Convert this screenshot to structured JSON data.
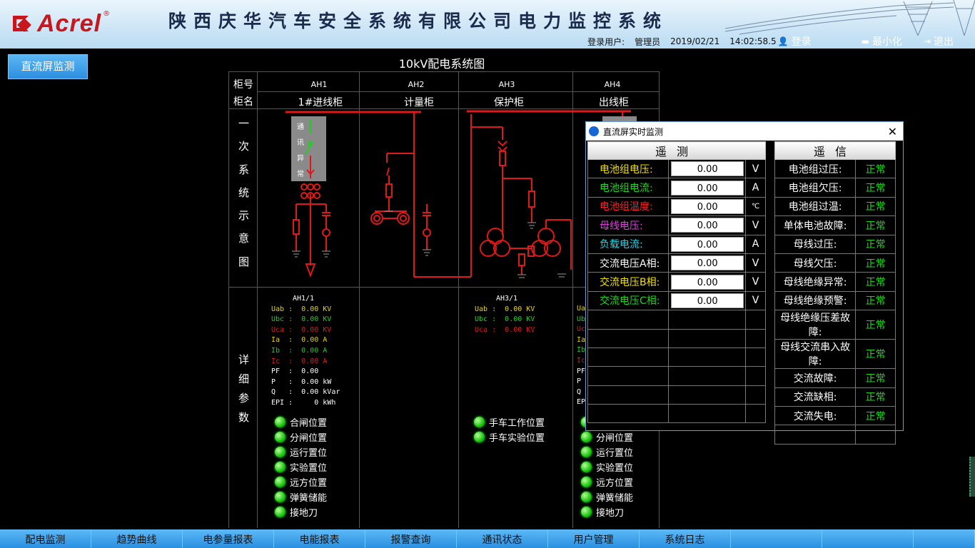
{
  "header": {
    "logo_text": "Acrel",
    "logo_reg": "®",
    "system_title": "陕西庆华汽车安全系统有限公司电力监控系统",
    "login_user_label": "登录用户:",
    "user_name": "管理员",
    "date": "2019/02/21",
    "time": "14:02:58.5",
    "login_btn": "登录",
    "minimize_btn": "最小化",
    "exit_btn": "退出"
  },
  "left_button": "直流屏监测",
  "diagram": {
    "title": "10kV配电系统图",
    "row_cabinet_no": "柜号",
    "row_cabinet_name": "柜名",
    "cabinets": [
      {
        "no": "AH1",
        "name": "1#进线柜"
      },
      {
        "no": "AH2",
        "name": "计量柜"
      },
      {
        "no": "AH3",
        "name": "保护柜"
      },
      {
        "no": "AH4",
        "name": "出线柜"
      }
    ],
    "primary_label": [
      "一",
      "次",
      "系",
      "统",
      "示",
      "意",
      "图"
    ],
    "detail_label": [
      "详",
      "细",
      "参",
      "数"
    ],
    "comm_fault": [
      "通",
      "讯",
      "异",
      "常"
    ],
    "ah1_meas": {
      "title": "AH1/1",
      "rows": [
        {
          "k": "Uab",
          "v": "0.00",
          "u": "KV",
          "c": "#e8d400"
        },
        {
          "k": "Ubc",
          "v": "0.00",
          "u": "KV",
          "c": "#19d219"
        },
        {
          "k": "Uca",
          "v": "0.00",
          "u": "KV",
          "c": "#e01a1a"
        },
        {
          "k": "Ia ",
          "v": "0.00",
          "u": "A",
          "c": "#e8d400"
        },
        {
          "k": "Ib ",
          "v": "0.00",
          "u": "A",
          "c": "#19d219"
        },
        {
          "k": "Ic ",
          "v": "0.00",
          "u": "A",
          "c": "#e01a1a"
        },
        {
          "k": "PF ",
          "v": "0.00",
          "u": "",
          "c": "#ffffff"
        },
        {
          "k": "P  ",
          "v": "0.00",
          "u": "kW",
          "c": "#ffffff"
        },
        {
          "k": "Q  ",
          "v": "0.00",
          "u": "kVar",
          "c": "#ffffff"
        },
        {
          "k": "EPI",
          "v": "   0",
          "u": "kWh",
          "c": "#ffffff"
        }
      ]
    },
    "ah3_meas": {
      "title": "AH3/1",
      "rows": [
        {
          "k": "Uab",
          "v": "0.00",
          "u": "KV",
          "c": "#e8d400"
        },
        {
          "k": "Ubc",
          "v": "0.00",
          "u": "KV",
          "c": "#19d219"
        },
        {
          "k": "Uca",
          "v": "0.00",
          "u": "KV",
          "c": "#e01a1a"
        }
      ]
    },
    "ah4_meas_partial": [
      {
        "k": "Ua",
        "c": "#e8d400"
      },
      {
        "k": "Ub",
        "c": "#19d219"
      },
      {
        "k": "Uc",
        "c": "#e01a1a"
      },
      {
        "k": "Ia",
        "c": "#e8d400"
      },
      {
        "k": "Ib",
        "c": "#19d219"
      },
      {
        "k": "Ic",
        "c": "#e01a1a"
      },
      {
        "k": "PF",
        "c": "#ffffff"
      },
      {
        "k": "P",
        "c": "#ffffff"
      },
      {
        "k": "Q",
        "c": "#ffffff"
      },
      {
        "k": "EP",
        "c": "#ffffff"
      }
    ],
    "ah1_leds": [
      "合闸位置",
      "分闸位置",
      "运行置位",
      "实验置位",
      "远方位置",
      "弹簧储能",
      "接地刀"
    ],
    "ah3_leds": [
      "手车工作位置",
      "手车实验位置"
    ],
    "ah4_leds": [
      "",
      "分闸位置",
      "运行置位",
      "实验置位",
      "远方位置",
      "弹簧储能",
      "接地刀"
    ]
  },
  "popup": {
    "title": "直流屏实时监测",
    "left_header": "遥测",
    "right_header": "遥信",
    "measure_rows": [
      {
        "label": "电池组电压:",
        "value": "0.00",
        "unit": "V",
        "color": "#f2e100"
      },
      {
        "label": "电池组电流:",
        "value": "0.00",
        "unit": "A",
        "color": "#1bd81b"
      },
      {
        "label": "电池组温度:",
        "value": "0.00",
        "unit": "℃",
        "color": "#ff2020"
      },
      {
        "label": "母线电压:",
        "value": "0.00",
        "unit": "V",
        "color": "#e040e0"
      },
      {
        "label": "负载电流:",
        "value": "0.00",
        "unit": "A",
        "color": "#20d8e8"
      },
      {
        "label": "交流电压A相:",
        "value": "0.00",
        "unit": "V",
        "color": "#ffffff"
      },
      {
        "label": "交流电压B相:",
        "value": "0.00",
        "unit": "V",
        "color": "#f2e100"
      },
      {
        "label": "交流电压C相:",
        "value": "0.00",
        "unit": "V",
        "color": "#1bd81b"
      }
    ],
    "status_rows": [
      {
        "label": "电池组过压:",
        "state": "正常"
      },
      {
        "label": "电池组欠压:",
        "state": "正常"
      },
      {
        "label": "电池组过温:",
        "state": "正常"
      },
      {
        "label": "单体电池故障:",
        "state": "正常"
      },
      {
        "label": "母线过压:",
        "state": "正常"
      },
      {
        "label": "母线欠压:",
        "state": "正常"
      },
      {
        "label": "母线绝缘异常:",
        "state": "正常"
      },
      {
        "label": "母线绝缘预警:",
        "state": "正常"
      },
      {
        "label": "母线绝缘压差故障:",
        "state": "正常"
      },
      {
        "label": "母线交流串入故障:",
        "state": "正常"
      },
      {
        "label": "交流故障:",
        "state": "正常"
      },
      {
        "label": "交流缺相:",
        "state": "正常"
      },
      {
        "label": "交流失电:",
        "state": "正常"
      },
      {
        "label": "",
        "state": ""
      }
    ]
  },
  "bottom_nav": [
    "配电监测",
    "趋势曲线",
    "电参量报表",
    "电能报表",
    "报警查询",
    "通讯状态",
    "用户管理",
    "系统日志",
    "",
    "",
    ""
  ]
}
